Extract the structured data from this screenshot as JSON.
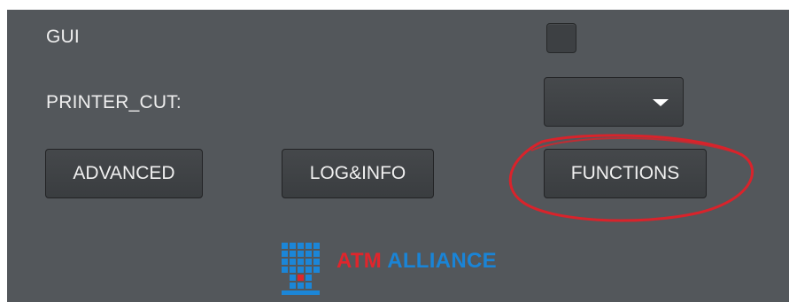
{
  "form": {
    "gui_label": "GUI",
    "printer_cut_label": "PRINTER_CUT:",
    "gui_checked": false,
    "printer_cut_value": ""
  },
  "buttons": {
    "advanced": "ADVANCED",
    "log_info": "LOG&INFO",
    "functions": "FUNCTIONS"
  },
  "logo": {
    "part1": "ATM",
    "part2": "ALLIANCE",
    "icon": "atm-alliance-logo-icon"
  },
  "colors": {
    "panel_bg": "#53575b",
    "annotation": "#e0252c",
    "logo_red": "#e0252c",
    "logo_blue": "#1a84d6"
  }
}
